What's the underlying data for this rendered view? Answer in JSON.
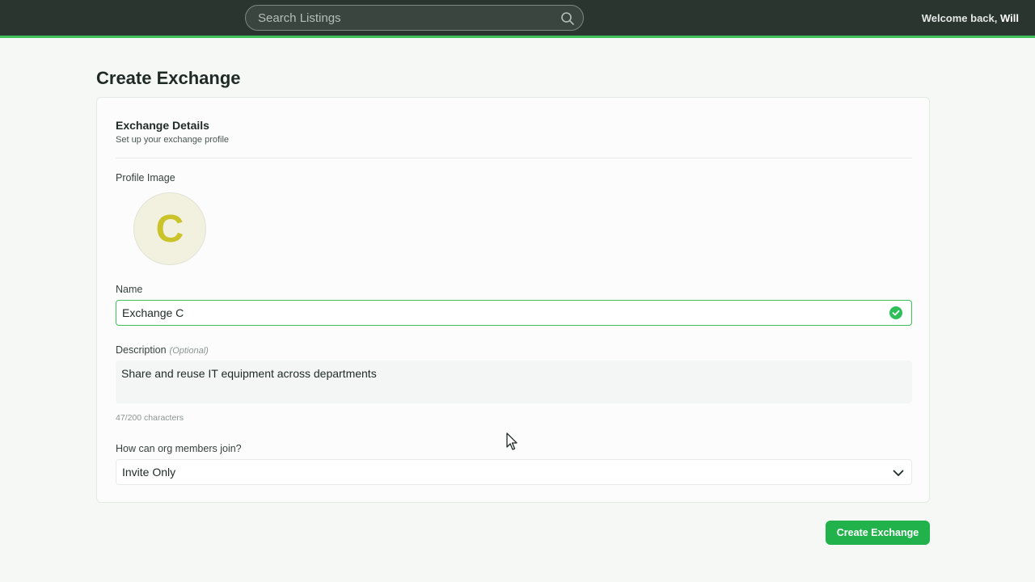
{
  "header": {
    "search_placeholder": "Search Listings",
    "welcome_prefix": "Welcome back, ",
    "user_name": "Will"
  },
  "page": {
    "title": "Create Exchange"
  },
  "card": {
    "title": "Exchange Details",
    "subtitle": "Set up your exchange profile"
  },
  "form": {
    "profile_image_label": "Profile Image",
    "avatar_letter": "C",
    "name_label": "Name",
    "name_value": "Exchange C",
    "description_label": "Description",
    "description_optional": "(Optional)",
    "description_value": "Share and reuse IT equipment across departments",
    "char_count": "47/200 characters",
    "join_label": "How can org members join?",
    "join_value": "Invite Only"
  },
  "actions": {
    "create_label": "Create Exchange"
  },
  "colors": {
    "accent": "#22b24c",
    "topbar": "#2a3530",
    "avatar_letter": "#cbc32a"
  },
  "icons": [
    "search-icon",
    "check-circle-icon",
    "chevron-down-icon",
    "cursor-icon"
  ]
}
